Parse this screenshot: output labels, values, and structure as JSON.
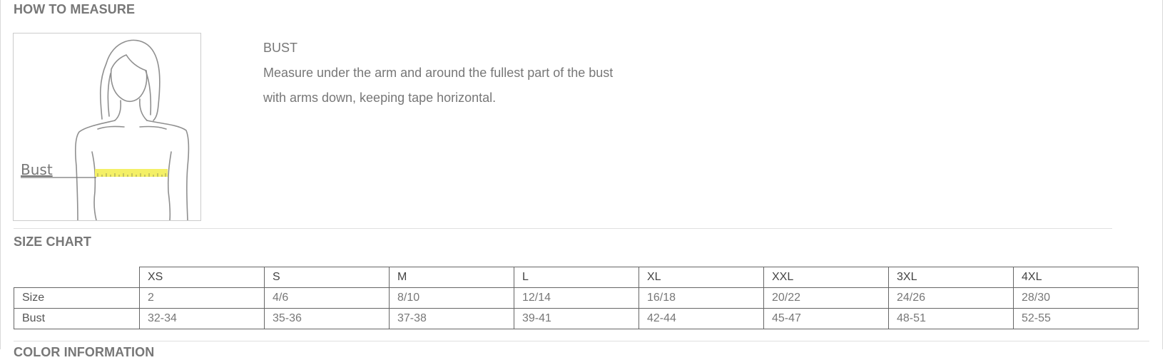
{
  "how_to_measure": {
    "heading": "HOW TO MEASURE",
    "figure_label": "Bust",
    "title": "BUST",
    "lines": [
      "Measure under the arm and around the fullest part of the bust",
      "with arms down, keeping tape horizontal."
    ]
  },
  "size_chart": {
    "heading": "SIZE CHART",
    "sizes": [
      "XS",
      "S",
      "M",
      "L",
      "XL",
      "XXL",
      "3XL",
      "4XL"
    ],
    "rows": [
      {
        "label": "Size",
        "values": [
          "2",
          "4/6",
          "8/10",
          "12/14",
          "16/18",
          "20/22",
          "24/26",
          "28/30"
        ]
      },
      {
        "label": "Bust",
        "values": [
          "32-34",
          "35-36",
          "37-38",
          "39-41",
          "42-44",
          "45-47",
          "48-51",
          "52-55"
        ]
      }
    ]
  },
  "color_information": {
    "heading": "COLOR INFORMATION"
  },
  "colors": {
    "tape": "#f4f067",
    "text": "#777777",
    "border": "#666666"
  }
}
